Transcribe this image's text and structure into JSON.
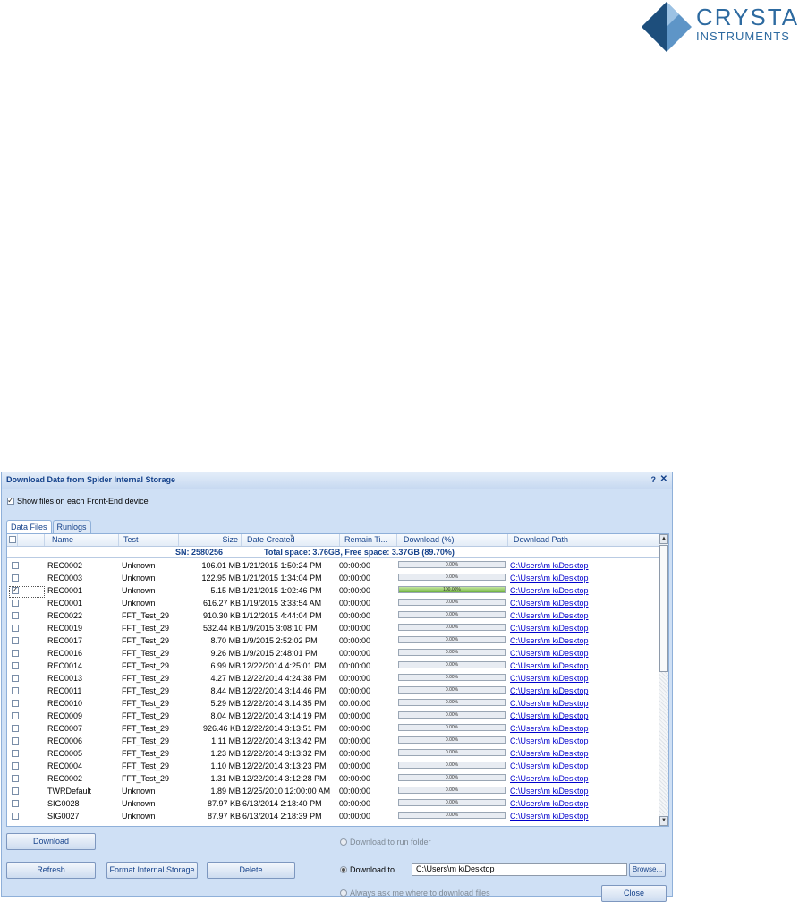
{
  "logo": {
    "line1": "CRYSTAL",
    "line2": "INSTRUMENTS",
    "colors": {
      "dark": "#1d4e7c",
      "light": "#5e95c7"
    }
  },
  "dialog": {
    "title": "Download Data from Spider Internal Storage",
    "help": "?",
    "close": "✕",
    "show_files_label": "Show files on each Front-End device",
    "show_files_checked": true,
    "tabs": [
      {
        "label": "Data Files",
        "active": true
      },
      {
        "label": "Runlogs",
        "active": false
      }
    ],
    "columns": [
      "Name",
      "Test",
      "Size",
      "Date Created",
      "Remain Ti...",
      "Download (%)",
      "Download Path"
    ],
    "sn": "SN: 2580256",
    "space": "Total space: 3.76GB,  Free space: 3.37GB (89.70%)",
    "rows": [
      {
        "checked": false,
        "name": "REC0002",
        "test": "Unknown",
        "size": "106.01 MB",
        "date": "1/21/2015 1:50:24 PM",
        "remain": "00:00:00",
        "progress": 0,
        "progress_label": "0.00%",
        "path": "C:\\Users\\m k\\Desktop"
      },
      {
        "checked": false,
        "name": "REC0003",
        "test": "Unknown",
        "size": "122.95 MB",
        "date": "1/21/2015 1:34:04 PM",
        "remain": "00:00:00",
        "progress": 0,
        "progress_label": "0.00%",
        "path": "C:\\Users\\m k\\Desktop"
      },
      {
        "checked": true,
        "name": "REC0001",
        "test": "Unknown",
        "size": "5.15 MB",
        "date": "1/21/2015 1:02:46 PM",
        "remain": "00:00:00",
        "progress": 100,
        "progress_label": "100.00%",
        "path": "C:\\Users\\m k\\Desktop"
      },
      {
        "checked": false,
        "name": "REC0001",
        "test": "Unknown",
        "size": "616.27 KB",
        "date": "1/19/2015 3:33:54 AM",
        "remain": "00:00:00",
        "progress": 0,
        "progress_label": "0.00%",
        "path": "C:\\Users\\m k\\Desktop"
      },
      {
        "checked": false,
        "name": "REC0022",
        "test": "FFT_Test_29",
        "size": "910.30 KB",
        "date": "1/12/2015 4:44:04 PM",
        "remain": "00:00:00",
        "progress": 0,
        "progress_label": "0.00%",
        "path": "C:\\Users\\m k\\Desktop"
      },
      {
        "checked": false,
        "name": "REC0019",
        "test": "FFT_Test_29",
        "size": "532.44 KB",
        "date": "1/9/2015 3:08:10 PM",
        "remain": "00:00:00",
        "progress": 0,
        "progress_label": "0.00%",
        "path": "C:\\Users\\m k\\Desktop"
      },
      {
        "checked": false,
        "name": "REC0017",
        "test": "FFT_Test_29",
        "size": "8.70 MB",
        "date": "1/9/2015 2:52:02 PM",
        "remain": "00:00:00",
        "progress": 0,
        "progress_label": "0.00%",
        "path": "C:\\Users\\m k\\Desktop"
      },
      {
        "checked": false,
        "name": "REC0016",
        "test": "FFT_Test_29",
        "size": "9.26 MB",
        "date": "1/9/2015 2:48:01 PM",
        "remain": "00:00:00",
        "progress": 0,
        "progress_label": "0.00%",
        "path": "C:\\Users\\m k\\Desktop"
      },
      {
        "checked": false,
        "name": "REC0014",
        "test": "FFT_Test_29",
        "size": "6.99 MB",
        "date": "12/22/2014 4:25:01 PM",
        "remain": "00:00:00",
        "progress": 0,
        "progress_label": "0.00%",
        "path": "C:\\Users\\m k\\Desktop"
      },
      {
        "checked": false,
        "name": "REC0013",
        "test": "FFT_Test_29",
        "size": "4.27 MB",
        "date": "12/22/2014 4:24:38 PM",
        "remain": "00:00:00",
        "progress": 0,
        "progress_label": "0.00%",
        "path": "C:\\Users\\m k\\Desktop"
      },
      {
        "checked": false,
        "name": "REC0011",
        "test": "FFT_Test_29",
        "size": "8.44 MB",
        "date": "12/22/2014 3:14:46 PM",
        "remain": "00:00:00",
        "progress": 0,
        "progress_label": "0.00%",
        "path": "C:\\Users\\m k\\Desktop"
      },
      {
        "checked": false,
        "name": "REC0010",
        "test": "FFT_Test_29",
        "size": "5.29 MB",
        "date": "12/22/2014 3:14:35 PM",
        "remain": "00:00:00",
        "progress": 0,
        "progress_label": "0.00%",
        "path": "C:\\Users\\m k\\Desktop"
      },
      {
        "checked": false,
        "name": "REC0009",
        "test": "FFT_Test_29",
        "size": "8.04 MB",
        "date": "12/22/2014 3:14:19 PM",
        "remain": "00:00:00",
        "progress": 0,
        "progress_label": "0.00%",
        "path": "C:\\Users\\m k\\Desktop"
      },
      {
        "checked": false,
        "name": "REC0007",
        "test": "FFT_Test_29",
        "size": "926.46 KB",
        "date": "12/22/2014 3:13:51 PM",
        "remain": "00:00:00",
        "progress": 0,
        "progress_label": "0.00%",
        "path": "C:\\Users\\m k\\Desktop"
      },
      {
        "checked": false,
        "name": "REC0006",
        "test": "FFT_Test_29",
        "size": "1.11 MB",
        "date": "12/22/2014 3:13:42 PM",
        "remain": "00:00:00",
        "progress": 0,
        "progress_label": "0.00%",
        "path": "C:\\Users\\m k\\Desktop"
      },
      {
        "checked": false,
        "name": "REC0005",
        "test": "FFT_Test_29",
        "size": "1.23 MB",
        "date": "12/22/2014 3:13:32 PM",
        "remain": "00:00:00",
        "progress": 0,
        "progress_label": "0.00%",
        "path": "C:\\Users\\m k\\Desktop"
      },
      {
        "checked": false,
        "name": "REC0004",
        "test": "FFT_Test_29",
        "size": "1.10 MB",
        "date": "12/22/2014 3:13:23 PM",
        "remain": "00:00:00",
        "progress": 0,
        "progress_label": "0.00%",
        "path": "C:\\Users\\m k\\Desktop"
      },
      {
        "checked": false,
        "name": "REC0002",
        "test": "FFT_Test_29",
        "size": "1.31 MB",
        "date": "12/22/2014 3:12:28 PM",
        "remain": "00:00:00",
        "progress": 0,
        "progress_label": "0.00%",
        "path": "C:\\Users\\m k\\Desktop"
      },
      {
        "checked": false,
        "name": "TWRDefault",
        "test": "Unknown",
        "size": "1.89 MB",
        "date": "12/25/2010 12:00:00 AM",
        "remain": "00:00:00",
        "progress": 0,
        "progress_label": "0.00%",
        "path": "C:\\Users\\m k\\Desktop"
      },
      {
        "checked": false,
        "name": "SIG0028",
        "test": "Unknown",
        "size": "87.97 KB",
        "date": "6/13/2014 2:18:40 PM",
        "remain": "00:00:00",
        "progress": 0,
        "progress_label": "0.00%",
        "path": "C:\\Users\\m k\\Desktop"
      },
      {
        "checked": false,
        "name": "SIG0027",
        "test": "Unknown",
        "size": "87.97 KB",
        "date": "6/13/2014 2:18:39 PM",
        "remain": "00:00:00",
        "progress": 0,
        "progress_label": "0.00%",
        "path": "C:\\Users\\m k\\Desktop"
      }
    ],
    "buttons": {
      "download": "Download",
      "refresh": "Refresh",
      "format": "Format Internal Storage",
      "delete": "Delete",
      "browse": "Browse...",
      "close": "Close"
    },
    "options": {
      "run_folder": "Download to run folder",
      "download_to": "Download to",
      "download_path": "C:\\Users\\m k\\Desktop",
      "always_ask": "Always ask me where to download files",
      "selected": "download_to"
    }
  }
}
